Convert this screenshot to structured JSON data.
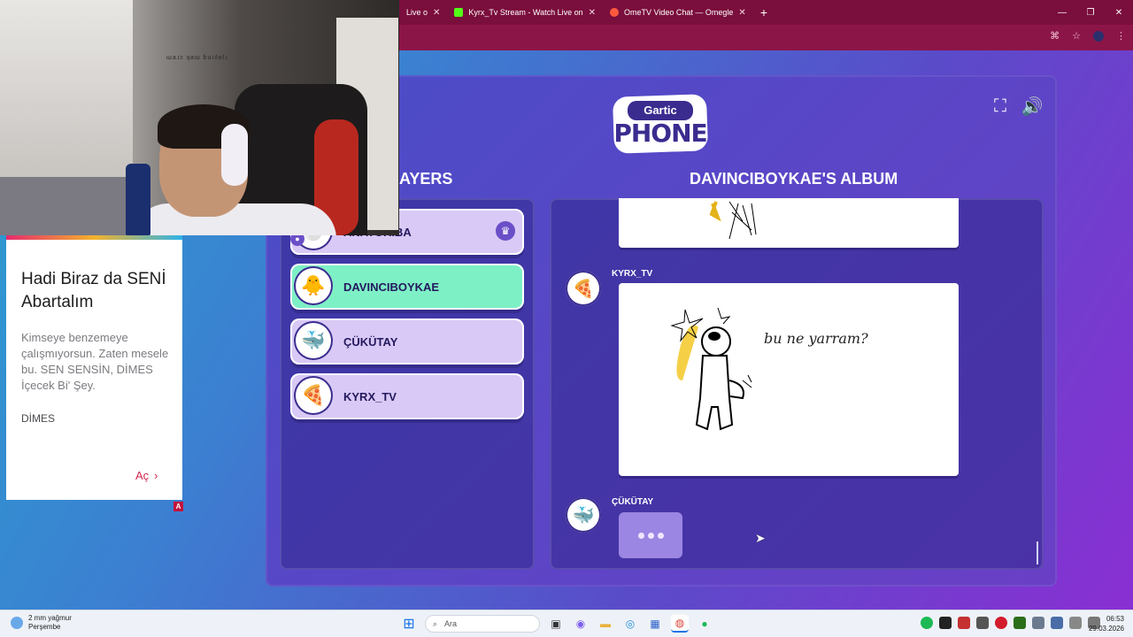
{
  "browser": {
    "tabs": [
      {
        "label": "Live o",
        "icon_color": "#7a0e3c"
      },
      {
        "label": "Kyrx_Tv Stream - Watch Live on",
        "icon_color": "#53fc18"
      },
      {
        "label": "OmeTV Video Chat — Omegle",
        "icon_color": "#ff5a3c"
      }
    ],
    "new_tab": "+",
    "controls": {
      "minimize": "—",
      "restore": "❐",
      "close": "✕"
    }
  },
  "game": {
    "logo_top": "Gartic",
    "logo_bottom": "PHONE",
    "players_title": "AYERS",
    "album_title": "DAVINCIBOYKAE'S ALBUM",
    "players": [
      {
        "name": "ANATORIBA",
        "avatar": "🐣",
        "crown": "♛",
        "user": "●"
      },
      {
        "name": "DAVINCIBOYKAE",
        "avatar": "🐥",
        "active": true
      },
      {
        "name": "ÇÜKÜTAY",
        "avatar": "🐳"
      },
      {
        "name": "KYRX_TV",
        "avatar": "🍕"
      }
    ],
    "album": [
      {
        "author": "KYRX_TV",
        "avatar": "🍕",
        "drawing_text": "bu ne yarram?"
      },
      {
        "author": "ÇÜKÜTAY",
        "avatar": "🐳"
      }
    ]
  },
  "webcam": {
    "caption": "ɯaɹɔ ʞaɯ ɓuıʎɐlɹ"
  },
  "ad": {
    "title": "Hadi Biraz da SENİ Abartalım",
    "body": "Kimseye benzemeye çalışmıyorsun. Zaten mesele bu. SEN SENSİN, DİMES İçecek Bi' Şey.",
    "brand": "DİMES",
    "cta": "Aç",
    "badge": "A"
  },
  "taskbar": {
    "weather_line1": "2 mm yağmur",
    "weather_line2": "Perşembe",
    "search_placeholder": "Ara",
    "time": "06:53",
    "date": "29.03.2026"
  }
}
